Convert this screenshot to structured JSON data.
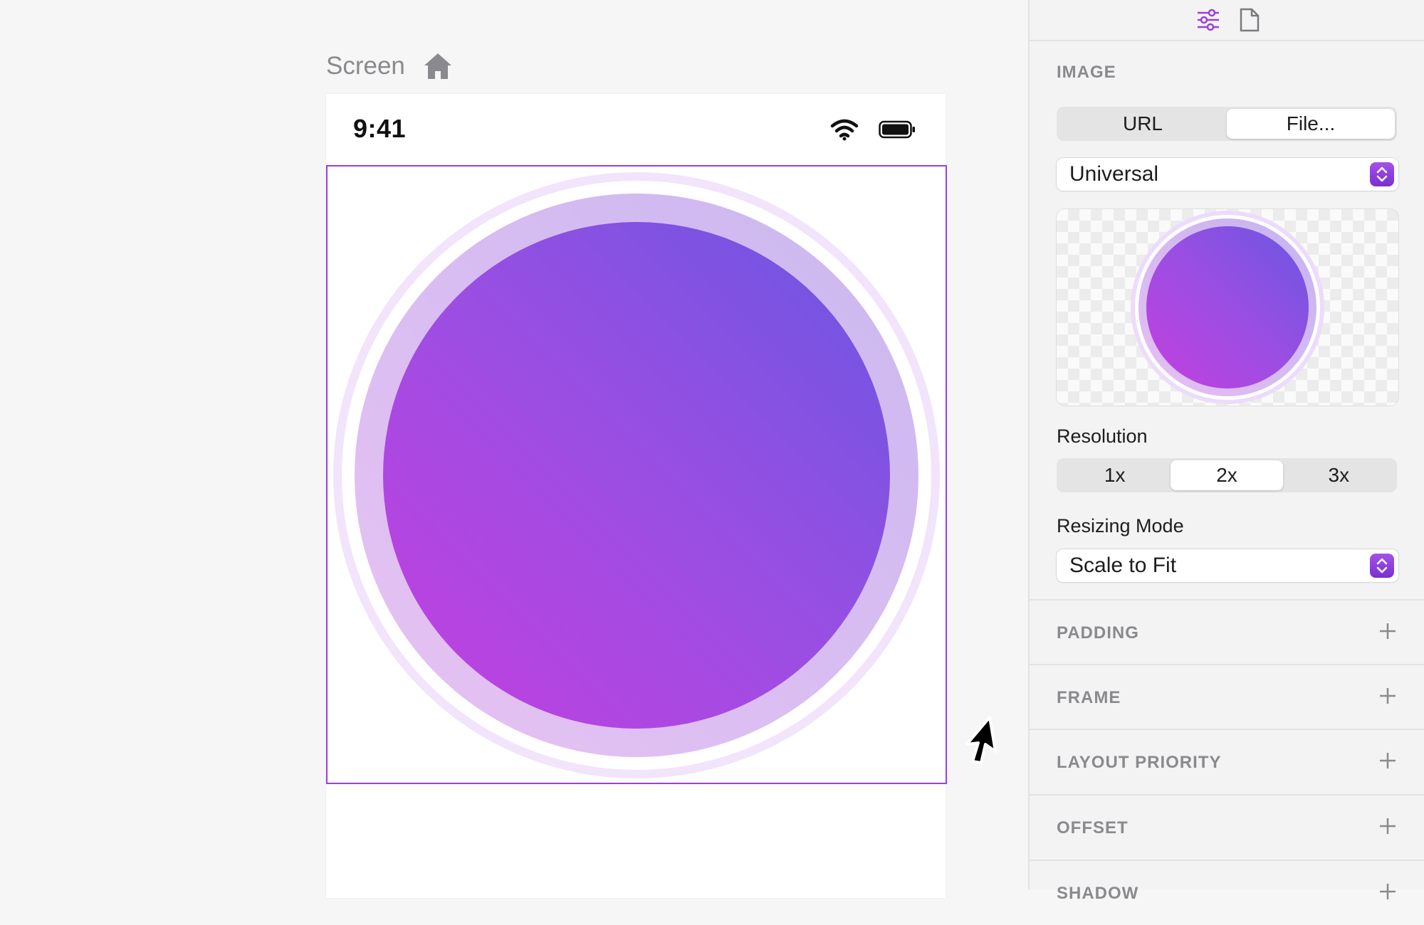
{
  "canvas": {
    "screen_title": "Screen",
    "status_bar": {
      "time": "9:41"
    }
  },
  "inspector": {
    "tabs": [
      "attributes-icon",
      "file-icon"
    ],
    "image": {
      "heading": "IMAGE",
      "source_options": [
        "URL",
        "File..."
      ],
      "source_selected": "File...",
      "device_popup": "Universal",
      "resolution_label": "Resolution",
      "resolution_options": [
        "1x",
        "2x",
        "3x"
      ],
      "resolution_selected": "2x",
      "resizing_label": "Resizing Mode",
      "resizing_popup": "Scale to Fit"
    },
    "sections": [
      {
        "title": "PADDING"
      },
      {
        "title": "FRAME"
      },
      {
        "title": "LAYOUT PRIORITY"
      },
      {
        "title": "OFFSET"
      },
      {
        "title": "SHADOW"
      }
    ]
  },
  "colors": {
    "accent": "#9b3fe0",
    "gradient_top_right": "#6a56e2",
    "gradient_bottom_left": "#c43fe0"
  }
}
